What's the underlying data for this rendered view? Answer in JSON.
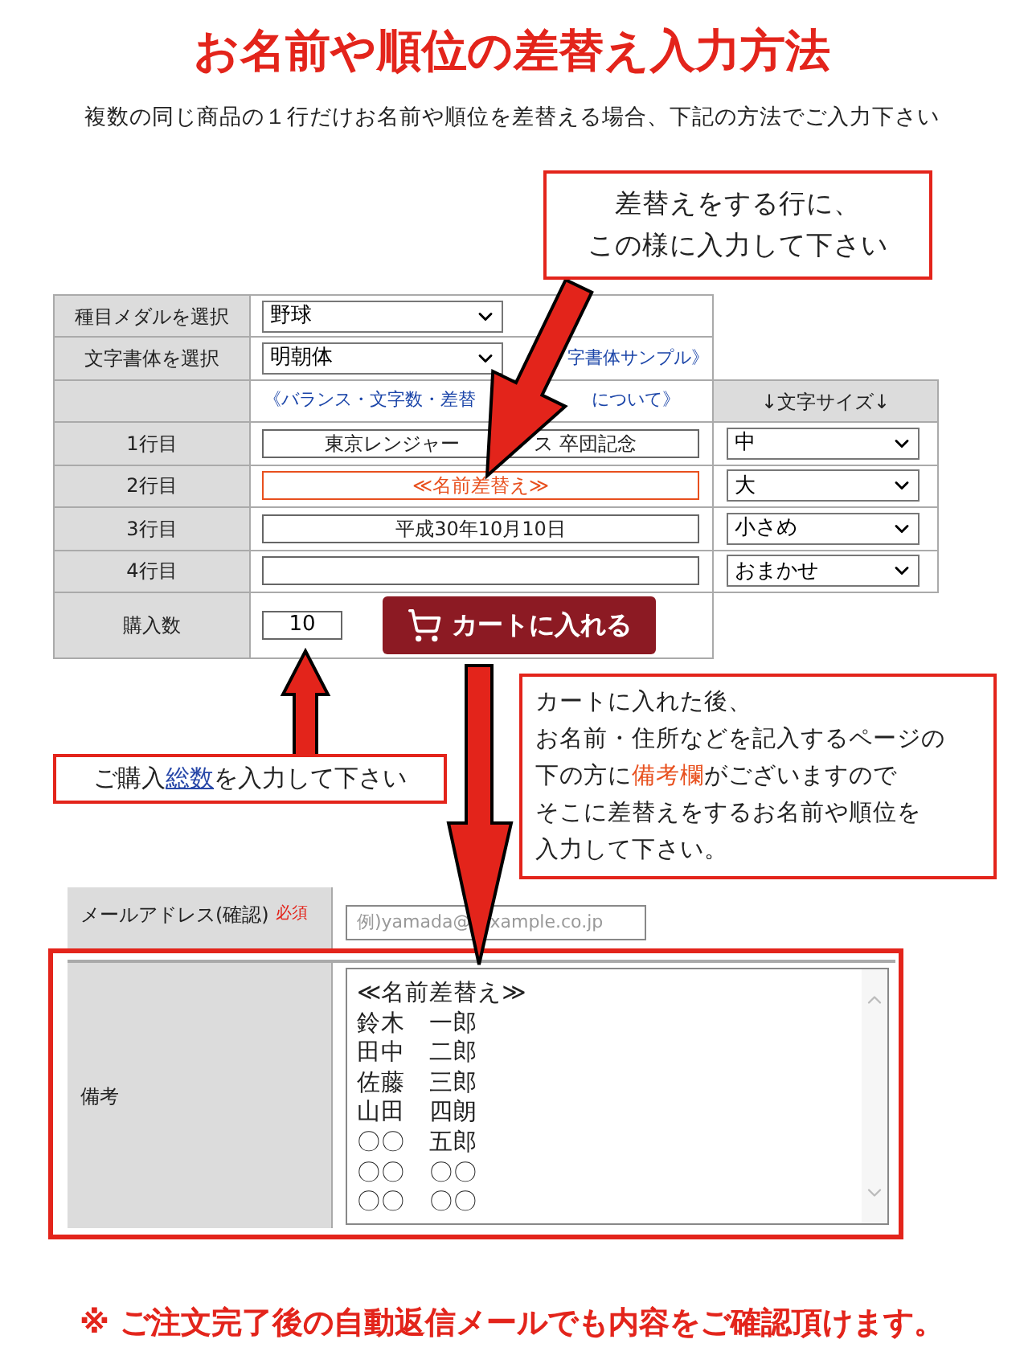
{
  "title": "お名前や順位の差替え入力方法",
  "subtitle": "複数の同じ商品の１行だけお名前や順位を差替える場合、下記の方法でご入力下さい",
  "callout_top": {
    "lines": [
      "差替えをする行に、",
      "この様に入力して下さい"
    ]
  },
  "order_form": {
    "medal_row": {
      "label": "種目メダルを選択",
      "value": "野球"
    },
    "font_row": {
      "label": "文字書体を選択",
      "value": "明朝体",
      "link": "字書体サンプル》"
    },
    "guide_row": {
      "link_parts": [
        "《バランス・文字数・差替",
        "について》"
      ],
      "size_header": "↓文字サイズ↓"
    },
    "lines": [
      {
        "label": "1行目",
        "value_parts": [
          "東京レンジャー",
          "ス 卒団記念"
        ],
        "highlight": false,
        "size": "中"
      },
      {
        "label": "2行目",
        "value_parts": [
          "≪名前差替え≫"
        ],
        "highlight": true,
        "size": "大"
      },
      {
        "label": "3行目",
        "value_parts": [
          "平成30年10月10日"
        ],
        "highlight": false,
        "size": "小さめ"
      },
      {
        "label": "4行目",
        "highlight": false,
        "size": "おまかせ"
      }
    ],
    "quantity": {
      "label": "購入数",
      "value": "10"
    },
    "cart_button": "カートに入れる"
  },
  "callout_quantity": {
    "before": "ご購入",
    "link": "総数",
    "after": "を入力して下さい"
  },
  "callout_remarks": {
    "lines": [
      [
        {
          "text": "カートに入れた後、",
          "highlight": false
        }
      ],
      [
        {
          "text": "お名前・住所などを記入するページの",
          "highlight": false
        }
      ],
      [
        {
          "text": "下の方に",
          "highlight": false
        },
        {
          "text": "備考欄",
          "highlight": true
        },
        {
          "text": "がございますので",
          "highlight": false
        }
      ],
      [
        {
          "text": "そこに差替えをするお名前や順位を",
          "highlight": false
        }
      ],
      [
        {
          "text": "入力して下さい。",
          "highlight": false
        }
      ]
    ]
  },
  "checkout_form": {
    "email_row": {
      "label": "メールアドレス(確認)",
      "required": "必須",
      "placeholder_parts": [
        "例)yamada@",
        "xample.co.jp"
      ]
    },
    "remarks_row": {
      "label": "備考",
      "lines": [
        "≪名前差替え≫",
        "鈴木　一郎",
        "田中　二郎",
        "佐藤　三郎",
        "山田　四朗",
        "〇〇　五郎",
        "〇〇　〇〇",
        "〇〇　〇〇"
      ]
    }
  },
  "footer_note": "※ ご注文完了後の自動返信メールでも内容をご確認頂けます。"
}
